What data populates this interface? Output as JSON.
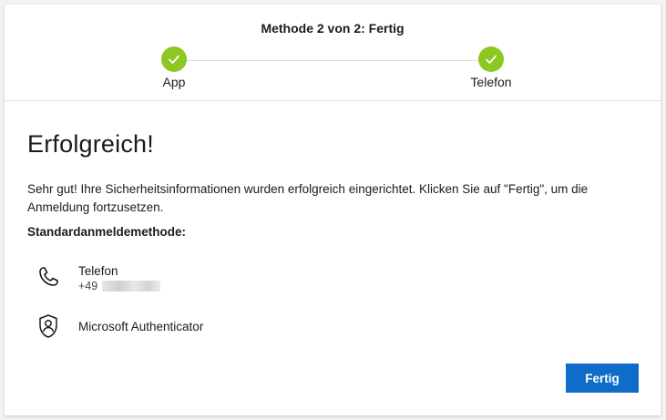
{
  "header": {
    "step_title": "Methode 2 von 2: Fertig",
    "steps": [
      {
        "label": "App",
        "status": "complete"
      },
      {
        "label": "Telefon",
        "status": "complete"
      }
    ],
    "complete_color": "#8bc821"
  },
  "main": {
    "title": "Erfolgreich!",
    "description": "Sehr gut! Ihre Sicherheitsinformationen wurden erfolgreich eingerichtet. Klicken Sie auf \"Fertig\", um die Anmeldung fortzusetzen.",
    "default_method_label": "Standardanmeldemethode:",
    "methods": [
      {
        "name": "Telefon",
        "detail": "+49",
        "icon": "phone-icon"
      },
      {
        "name": "Microsoft Authenticator",
        "icon": "authenticator-lock-icon"
      }
    ]
  },
  "footer": {
    "done_label": "Fertig",
    "accent_color": "#0f6cc8"
  }
}
